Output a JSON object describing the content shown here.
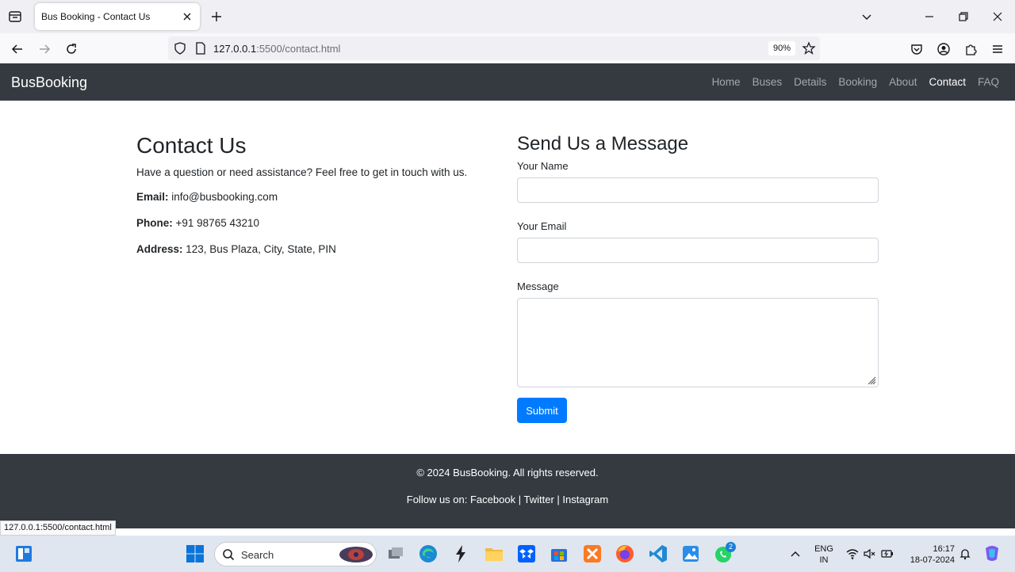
{
  "browser": {
    "tab_title": "Bus Booking - Contact Us",
    "url_host": "127.0.0.1",
    "url_path": ":5500/contact.html",
    "zoom": "90%",
    "status_url": "127.0.0.1:5500/contact.html"
  },
  "site": {
    "brand": "BusBooking",
    "nav": [
      "Home",
      "Buses",
      "Details",
      "Booking",
      "About",
      "Contact",
      "FAQ"
    ],
    "active_nav": "Contact"
  },
  "contact": {
    "title": "Contact Us",
    "intro": "Have a question or need assistance? Feel free to get in touch with us.",
    "email_label": "Email:",
    "email_value": "info@busbooking.com",
    "phone_label": "Phone:",
    "phone_value": "+91 98765 43210",
    "address_label": "Address:",
    "address_value": "123, Bus Plaza, City, State, PIN"
  },
  "form": {
    "title": "Send Us a Message",
    "name_label": "Your Name",
    "name_value": "",
    "email_label": "Your Email",
    "email_value": "",
    "message_label": "Message",
    "message_value": "",
    "submit_label": "Submit"
  },
  "footer": {
    "copyright": "© 2024 BusBooking. All rights reserved.",
    "follow_prefix": "Follow us on:",
    "facebook": "Facebook",
    "twitter": "Twitter",
    "instagram": "Instagram",
    "separator": "|"
  },
  "taskbar": {
    "search_placeholder": "Search",
    "lang_line1": "ENG",
    "lang_line2": "IN",
    "time": "16:17",
    "date": "18-07-2024",
    "whatsapp_badge": "2"
  },
  "colors": {
    "navbar_bg": "#343a40",
    "primary": "#007bff"
  }
}
